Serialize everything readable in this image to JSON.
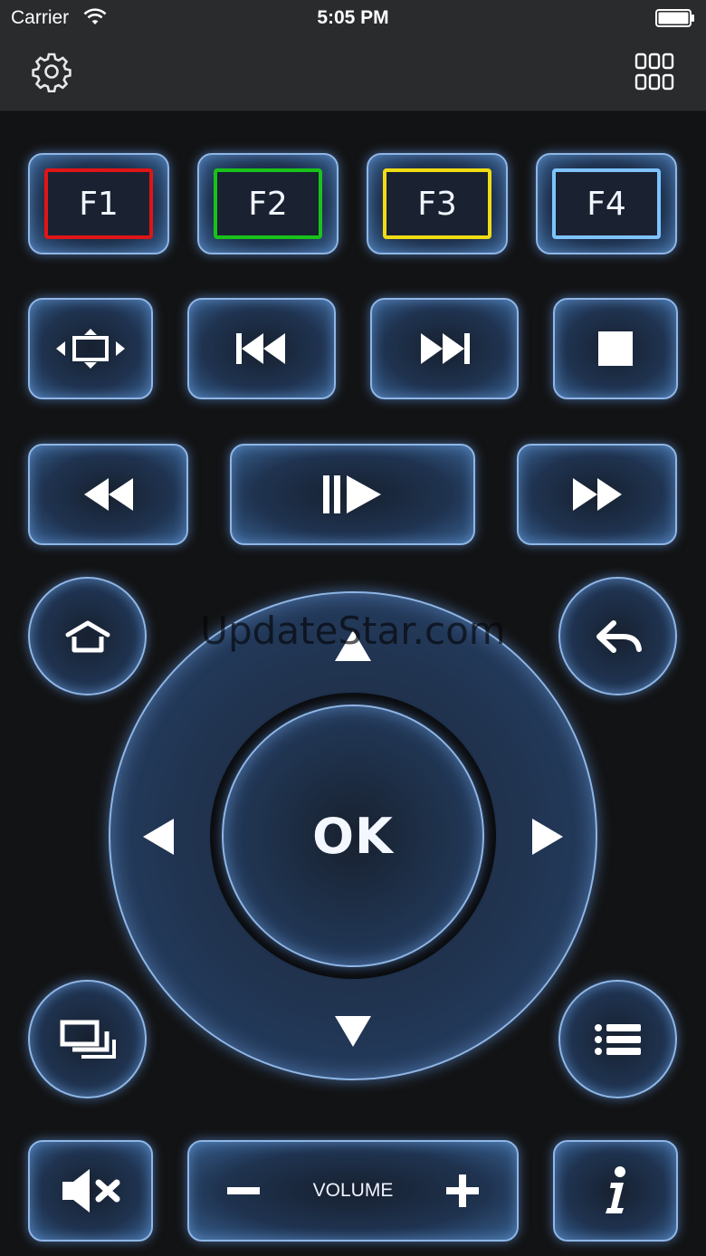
{
  "status_bar": {
    "carrier": "Carrier",
    "time": "5:05 PM"
  },
  "nav": {
    "settings_icon": "gear-icon",
    "grid_icon": "grid-icon"
  },
  "function_keys": [
    {
      "label": "F1",
      "color": "#e01515"
    },
    {
      "label": "F2",
      "color": "#19c219"
    },
    {
      "label": "F3",
      "color": "#f1dc13"
    },
    {
      "label": "F4",
      "color": "#7ec3ff"
    }
  ],
  "dpad": {
    "ok_label": "OK"
  },
  "volume": {
    "label": "VOLUME"
  },
  "watermark": "UpdateStar.com",
  "colors": {
    "glow": "#8fb6e6",
    "background": "#121314",
    "bar": "#2a2b2d"
  }
}
